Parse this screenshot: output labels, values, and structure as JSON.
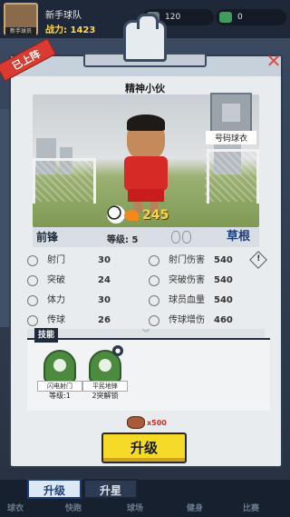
{
  "header": {
    "avatar_tag": "新手球员",
    "team_name": "新手球队",
    "power_label": "战力:",
    "power_value": "1423",
    "resource_1": "120",
    "resource_2": "0"
  },
  "nav": [
    "球衣",
    "快跑",
    "球场",
    "健身",
    "比赛"
  ],
  "modal": {
    "status_ribbon": "已上阵",
    "player_name": "精神小伙",
    "jersey_label": "号码球衣",
    "rating": "245",
    "position_tag": "前锋",
    "level": "等级: 5",
    "grade_tag": "草根"
  },
  "stats": [
    {
      "label": "射门",
      "value": "30",
      "icon": "shoot-icon"
    },
    {
      "label": "射门伤害",
      "value": "540",
      "icon": "shoot-damage-icon"
    },
    {
      "label": "突破",
      "value": "24",
      "icon": "breakthrough-icon"
    },
    {
      "label": "突破伤害",
      "value": "540",
      "icon": "breakthrough-damage-icon"
    },
    {
      "label": "体力",
      "value": "30",
      "icon": "stamina-icon"
    },
    {
      "label": "球员血量",
      "value": "540",
      "icon": "player-hp-icon"
    },
    {
      "label": "传球",
      "value": "26",
      "icon": "pass-icon"
    },
    {
      "label": "传球增伤",
      "value": "460",
      "icon": "pass-bonus-icon"
    }
  ],
  "skills": {
    "tag": "技能",
    "items": [
      {
        "name": "闪电射门",
        "sub": "等级:1",
        "icon": "lightning-shot-icon",
        "locked": false
      },
      {
        "name": "平民地锋",
        "sub": "2突解锁",
        "icon": "civilian-forward-icon",
        "locked": true
      }
    ]
  },
  "upgrade": {
    "cost": "x500",
    "button_label": "升级"
  },
  "tabs": [
    {
      "label": "升级",
      "active": true
    },
    {
      "label": "升星",
      "active": false
    }
  ]
}
